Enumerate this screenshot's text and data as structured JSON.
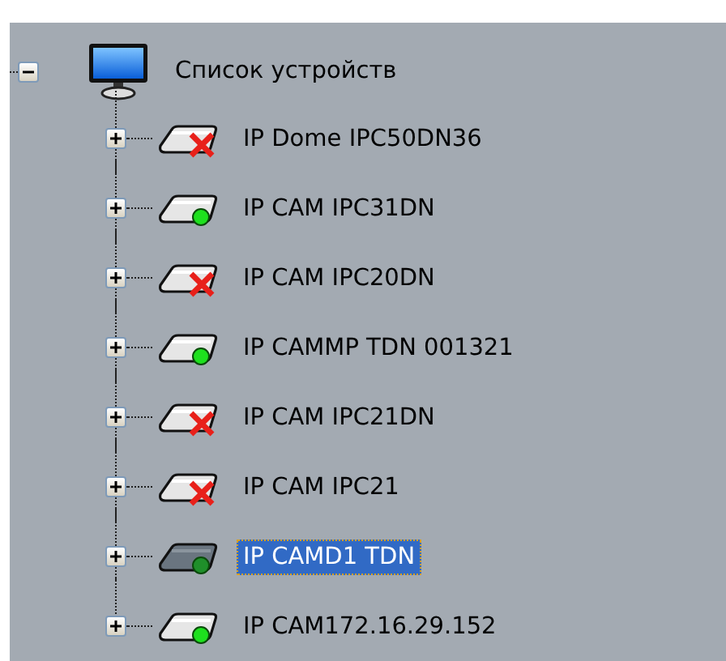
{
  "tree": {
    "label": "Список устройств",
    "expanded": true,
    "selected": false,
    "children": [
      {
        "label": "IP Dome IPC50DN36",
        "online": false,
        "expanded": false,
        "selected": false
      },
      {
        "label": "IP CAM IPC31DN",
        "online": true,
        "expanded": false,
        "selected": false
      },
      {
        "label": "IP CAM IPC20DN",
        "online": false,
        "expanded": false,
        "selected": false
      },
      {
        "label": "IP CAMMP TDN 001321",
        "online": true,
        "expanded": false,
        "selected": false
      },
      {
        "label": "IP CAM IPC21DN",
        "online": false,
        "expanded": false,
        "selected": false
      },
      {
        "label": "IP CAM IPC21",
        "online": false,
        "expanded": false,
        "selected": false
      },
      {
        "label": "IP CAMD1 TDN",
        "online": true,
        "expanded": false,
        "selected": true
      },
      {
        "label": "IP CAM172.16.29.152",
        "online": true,
        "expanded": false,
        "selected": false
      }
    ]
  }
}
